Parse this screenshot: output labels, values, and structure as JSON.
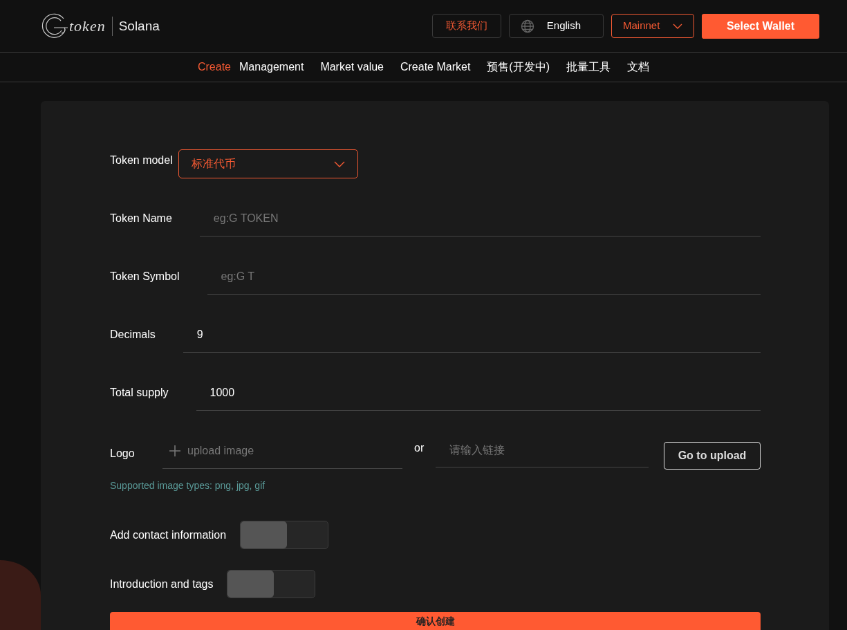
{
  "header": {
    "logo_text": "token",
    "chain": "Solana",
    "contact_button": "联系我们",
    "language_button": "English",
    "network_select": "Mainnet",
    "wallet_button": "Select Wallet"
  },
  "nav": [
    {
      "label": "Create",
      "selected": true
    },
    {
      "label": "Management",
      "selected": false
    },
    {
      "label": "Market value",
      "selected": false
    },
    {
      "label": "Create Market",
      "selected": false
    },
    {
      "label": "预售(开发中)",
      "selected": false
    },
    {
      "label": "批量工具",
      "selected": false
    },
    {
      "label": "文档",
      "selected": false
    }
  ],
  "form": {
    "token_model": {
      "label": "Token model",
      "value": "标准代币"
    },
    "fields": [
      {
        "label": "Token Name",
        "placeholder": "eg:G TOKEN"
      },
      {
        "label": "Token Symbol",
        "placeholder": "eg:G T"
      },
      {
        "label": "Decimals",
        "value": "9"
      },
      {
        "label": "Total supply",
        "value": "1000"
      }
    ],
    "logo": {
      "label": "Logo",
      "upload_placeholder": "upload image",
      "or": "or",
      "link_placeholder": "请输入链接",
      "upload_button": "Go to upload",
      "hint": "Supported image types: png, jpg, gif"
    },
    "toggles": [
      {
        "label": "Add contact information",
        "on": false
      },
      {
        "label": "Introduction and tags",
        "on": false
      }
    ],
    "submit_button": "确认创建"
  }
}
